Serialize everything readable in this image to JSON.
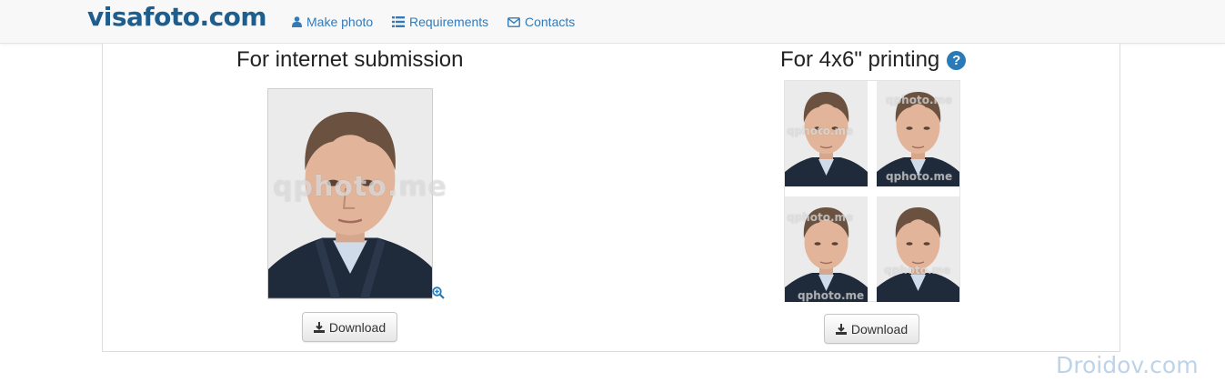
{
  "navbar": {
    "brand": "visafoto.com",
    "links": [
      {
        "label": "Make photo",
        "icon": "user-icon"
      },
      {
        "label": "Requirements",
        "icon": "list-icon"
      },
      {
        "label": "Contacts",
        "icon": "envelope-icon"
      }
    ]
  },
  "internet": {
    "title": "For internet submission",
    "watermark": "qphoto.me",
    "download_label": "Download"
  },
  "printing": {
    "title": "For 4x6\" printing",
    "help_icon": "?",
    "tile_watermark": "qphoto.me",
    "download_label": "Download"
  },
  "overlay": {
    "watermark": "Droidov.com"
  },
  "colors": {
    "brand": "#1d5e8f",
    "link": "#337ab7",
    "help": "#2a7ab7"
  }
}
